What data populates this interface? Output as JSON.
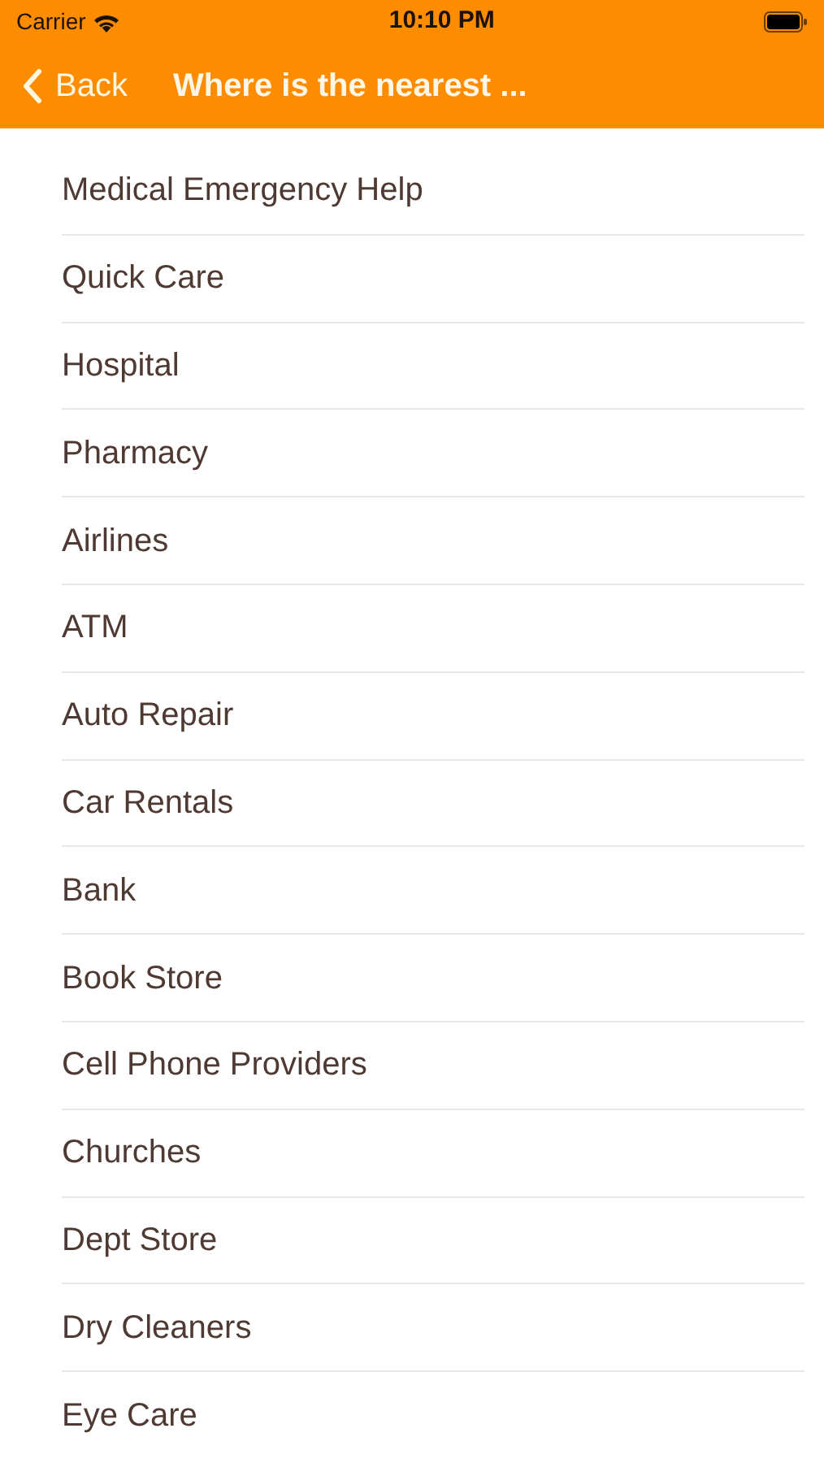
{
  "status_bar": {
    "carrier": "Carrier",
    "time": "10:10 PM"
  },
  "nav_bar": {
    "back": "Back",
    "title": "Where is the nearest ..."
  },
  "items": [
    "Medical Emergency Help",
    "Quick Care",
    "Hospital",
    "Pharmacy",
    "Airlines",
    "ATM",
    "Auto Repair",
    "Car Rentals",
    "Bank",
    "Book Store",
    "Cell Phone Providers",
    "Churches",
    "Dept Store",
    "Dry Cleaners",
    "Eye Care"
  ]
}
